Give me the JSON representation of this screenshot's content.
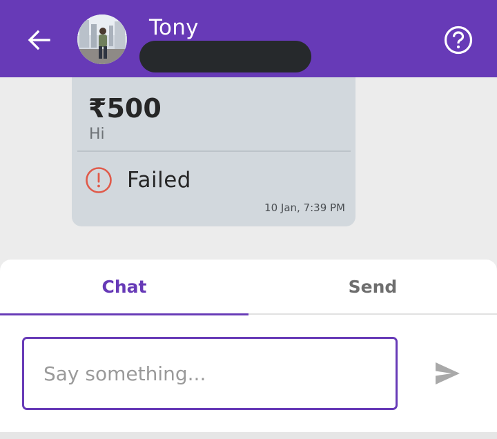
{
  "header": {
    "contact_name": "Tony",
    "back_icon": "arrow-left-icon",
    "help_icon": "question-circle-icon",
    "background_color": "#673ab7"
  },
  "message": {
    "amount": "₹500",
    "note": "Hi",
    "status": "Failed",
    "status_icon": "exclamation-circle-icon",
    "status_color": "#e05a4a",
    "timestamp": "10 Jan, 7:39 PM"
  },
  "tabs": [
    {
      "label": "Chat",
      "active": true
    },
    {
      "label": "Send",
      "active": false
    }
  ],
  "composer": {
    "placeholder": "Say something...",
    "value": "",
    "send_icon": "send-icon"
  },
  "colors": {
    "accent": "#673ab7",
    "bubble": "#d2d8dd",
    "failed": "#e05a4a"
  }
}
